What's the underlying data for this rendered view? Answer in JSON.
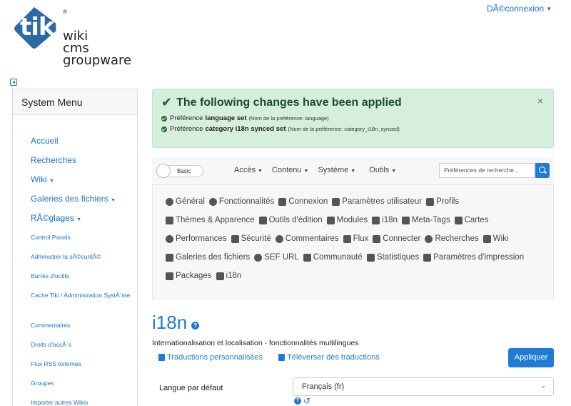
{
  "header": {
    "logo_mark": "tiki",
    "logo_reg": "®",
    "logo_lines": [
      "wiki",
      "cms",
      "groupware"
    ],
    "user_menu": "DÃ©connexion"
  },
  "sidebar": {
    "title": "System Menu",
    "items": [
      {
        "label": "Accueil"
      },
      {
        "label": "Recherches"
      },
      {
        "label": "Wiki",
        "caret": true
      },
      {
        "label": "Galeries des fichiers",
        "caret": true
      },
      {
        "label": "RÃ©glages",
        "caret": true
      },
      {
        "label": "Control Panels"
      },
      {
        "label": "Administrer la sÃ©curitÃ©"
      },
      {
        "label": "Barres d'outils"
      },
      {
        "label": "Cache Tiki / Administration SystÃ¨me"
      },
      {
        "label": "Commentaires"
      },
      {
        "label": "Droits d'accÃ¨s"
      },
      {
        "label": "Flux RSS externes"
      },
      {
        "label": "Groupes"
      },
      {
        "label": "Importer autres Wikis"
      }
    ]
  },
  "alert": {
    "title": "The following changes have been applied",
    "close": "×",
    "lines": [
      {
        "prefix": "Préférence",
        "bold": "language set",
        "note": "(Nom de la préférence: language)"
      },
      {
        "prefix": "Préférence",
        "bold": "category i18n synced set",
        "note": "(Nom de la préférence: category_i18n_synced)"
      }
    ]
  },
  "toolbar": {
    "mode": "Basic",
    "menus": [
      "Accès",
      "Contenu",
      "Système",
      "Outils"
    ],
    "search_placeholder": "Préférences de recherche..."
  },
  "categories": [
    {
      "label": "Général",
      "icon": "gear-icon"
    },
    {
      "label": "Fonctionnalités",
      "icon": "power-icon"
    },
    {
      "label": "Connexion",
      "icon": "sign-in-icon"
    },
    {
      "label": "Paramètres utilisateur",
      "icon": "user-icon"
    },
    {
      "label": "Profils",
      "icon": "cube-icon"
    },
    {
      "label": "Thèmes & Apparence",
      "icon": "image-icon"
    },
    {
      "label": "Outils d'édition",
      "icon": "edit-icon"
    },
    {
      "label": "Modules",
      "icon": "cubes-icon"
    },
    {
      "label": "i18n",
      "icon": "language-icon"
    },
    {
      "label": "Meta-Tags",
      "icon": "tag-icon"
    },
    {
      "label": "Cartes",
      "icon": "map-marker-icon"
    },
    {
      "label": "Performances",
      "icon": "tachometer-icon"
    },
    {
      "label": "Sécurité",
      "icon": "lock-icon"
    },
    {
      "label": "Commentaires",
      "icon": "comment-icon"
    },
    {
      "label": "Flux",
      "icon": "rss-icon"
    },
    {
      "label": "Connecter",
      "icon": "link-icon"
    },
    {
      "label": "Recherches",
      "icon": "search-icon"
    },
    {
      "label": "Wiki",
      "icon": "file-icon"
    },
    {
      "label": "Galeries des fichiers",
      "icon": "folder-icon"
    },
    {
      "label": "SEF URL",
      "icon": "search-plus-icon"
    },
    {
      "label": "Communauté",
      "icon": "users-icon"
    },
    {
      "label": "Statistiques",
      "icon": "chart-icon"
    },
    {
      "label": "Paramètres d'impression",
      "icon": "print-icon"
    },
    {
      "label": "Packages",
      "icon": "gift-icon"
    },
    {
      "label": "i18n",
      "icon": "bullhorn-icon"
    }
  ],
  "main": {
    "title": "i18n",
    "help": "?",
    "subtitle": "Internationalisation et localisation - fonctionnalités multilingues",
    "link_custom": "Traductions personnalisées",
    "link_upload": "Téléverser des traductions",
    "apply": "Appliquer",
    "default_lang_label": "Langue par défaut",
    "default_lang_value": "Français (fr)"
  }
}
